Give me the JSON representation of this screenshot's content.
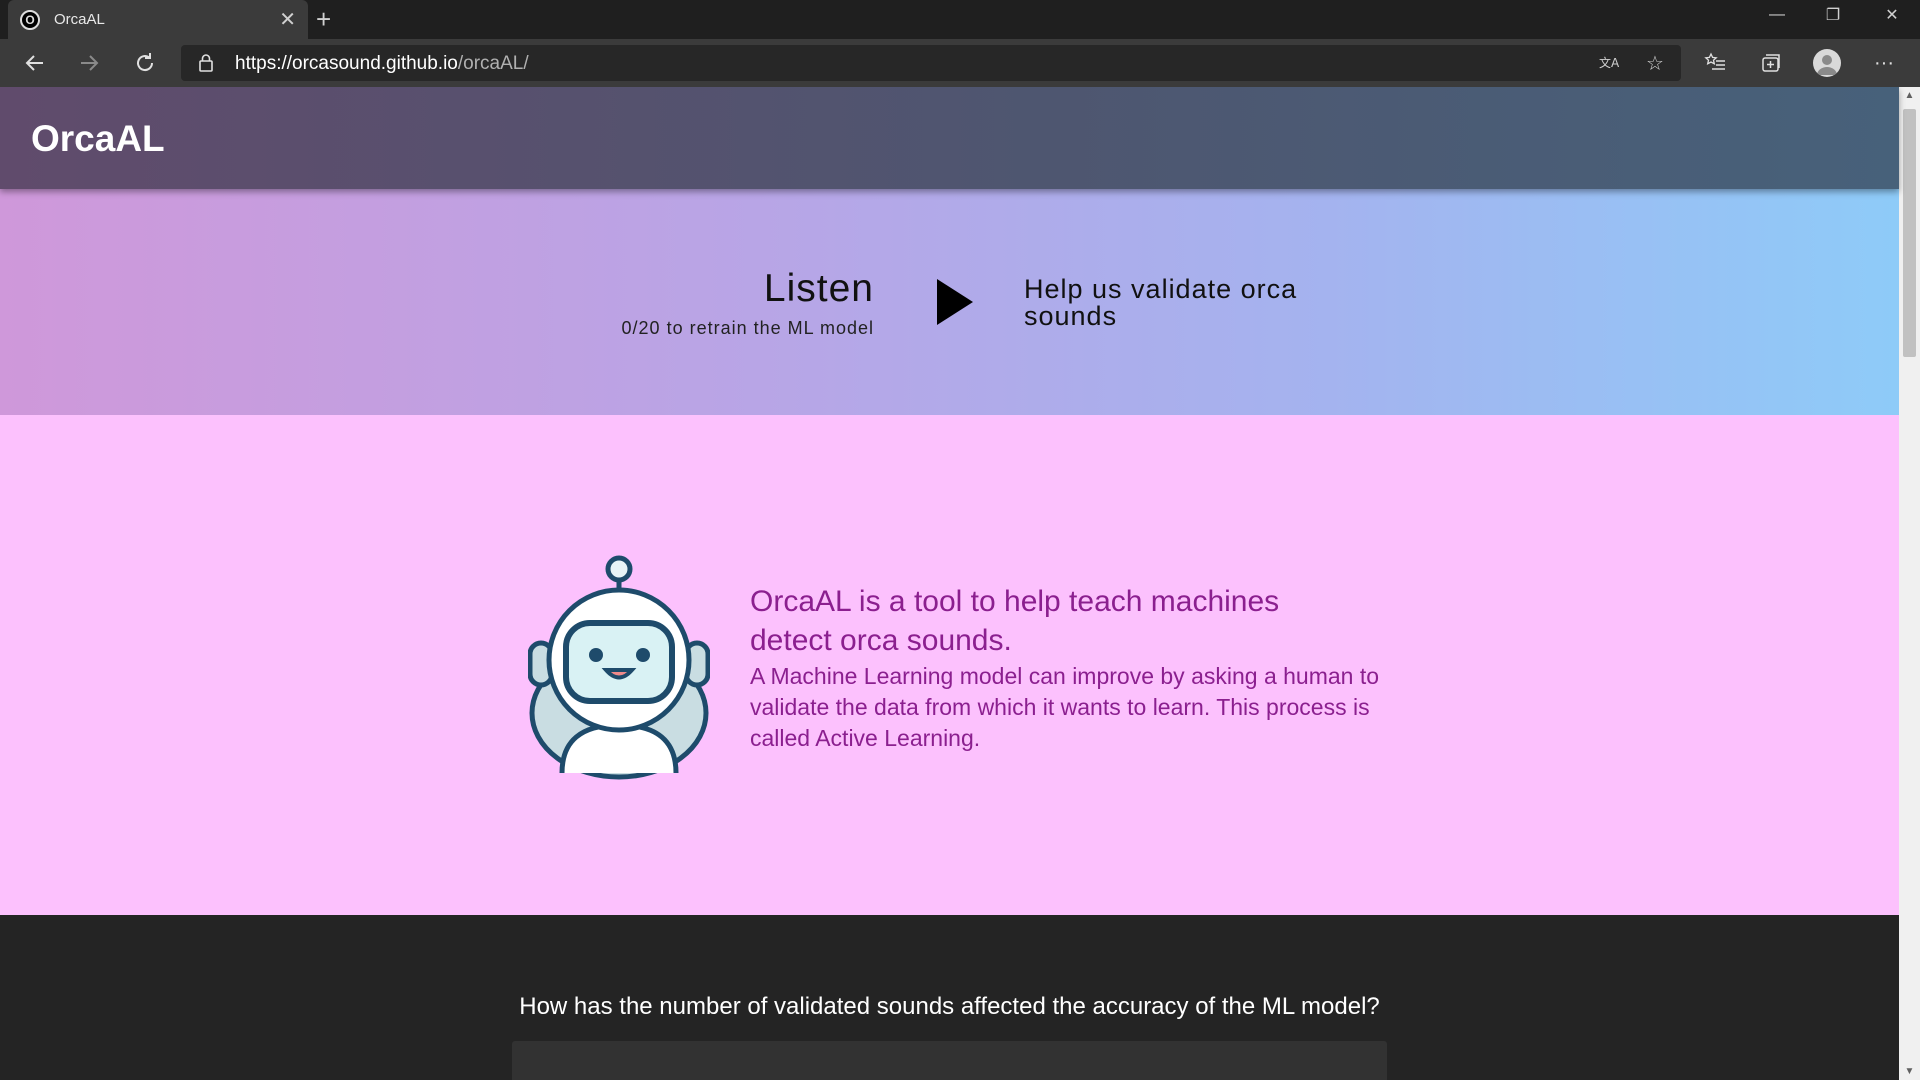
{
  "browser": {
    "tab": {
      "title": "OrcaAL",
      "favicon_letter": "O"
    },
    "window_controls": {
      "minimize": "—",
      "restore": "❐",
      "close": "✕"
    },
    "new_tab": "+",
    "url": {
      "host": "https://orcasound.github.io",
      "path": "/orcaAL/"
    },
    "icons": [
      "back-icon",
      "forward-icon",
      "refresh-icon",
      "lock-icon",
      "translate-icon",
      "star-icon",
      "favorites-icon",
      "collections-icon",
      "profile-icon",
      "more-icon"
    ]
  },
  "header": {
    "title": "OrcaAL"
  },
  "listen": {
    "title": "Listen",
    "progress": "0/20 to retrain the ML model",
    "help": "Help us validate orca sounds"
  },
  "about": {
    "heading": "OrcaAL is a tool to help teach machines detect orca sounds.",
    "body": "A Machine Learning model can improve by asking a human to validate the data from which it wants to learn. This process is called Active Learning."
  },
  "chart_section": {
    "question": "How has the number of validated sounds affected the accuracy of the ML model?"
  },
  "colors": {
    "header_left": "#604b6c",
    "header_right": "#47617a",
    "listen_left": "#cf98da",
    "listen_right": "#8ecbf8",
    "about_bg": "#fcc1fd",
    "about_text": "#8b1f8f",
    "dark_bg": "#242424"
  }
}
